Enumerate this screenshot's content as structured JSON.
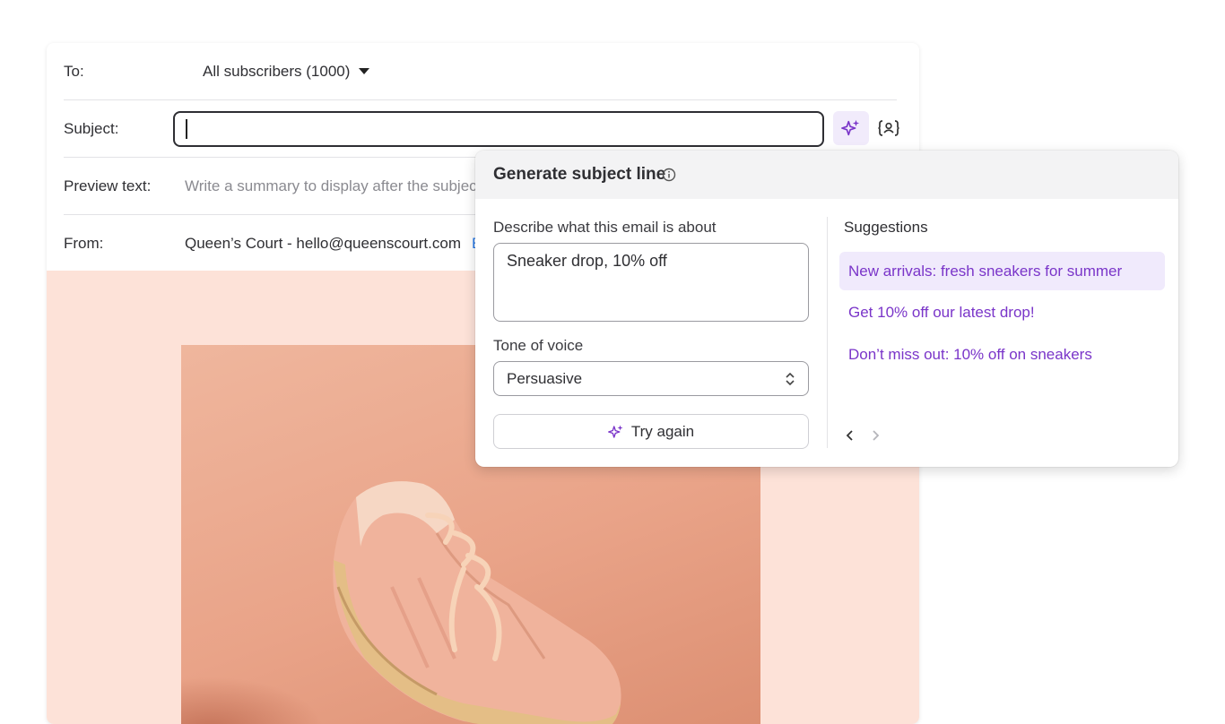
{
  "email": {
    "to_label": "To:",
    "recipients": "All subscribers (1000)",
    "subject_label": "Subject:",
    "subject_value": "",
    "preview_label": "Preview text:",
    "preview_placeholder": "Write a summary to display after the subjec",
    "from_label": "From:",
    "from_value": "Queen’s Court - hello@queenscourt.com",
    "from_edit": "E"
  },
  "generator": {
    "title": "Generate subject line",
    "describe_label": "Describe what this email is about",
    "describe_value": "Sneaker drop, 10% off",
    "tone_label": "Tone of voice",
    "tone_value": "Persuasive",
    "try_again": "Try again",
    "suggestions_title": "Suggestions",
    "suggestions": [
      "New arrivals: fresh sneakers for summer",
      "Get 10% off our latest drop!",
      "Don’t miss out: 10% off on sneakers"
    ]
  },
  "icons": {
    "ai": "sparkle-icon",
    "vars": "personalization-icon",
    "info": "info-icon",
    "updown": "chevron-updown-icon",
    "prev": "chevron-left-icon",
    "next": "chevron-right-icon"
  },
  "colors": {
    "accent": "#7a35c9",
    "suggestion_active_bg": "#f0eafc",
    "hero_bg": "#fde2d8",
    "link": "#2c7be5"
  }
}
